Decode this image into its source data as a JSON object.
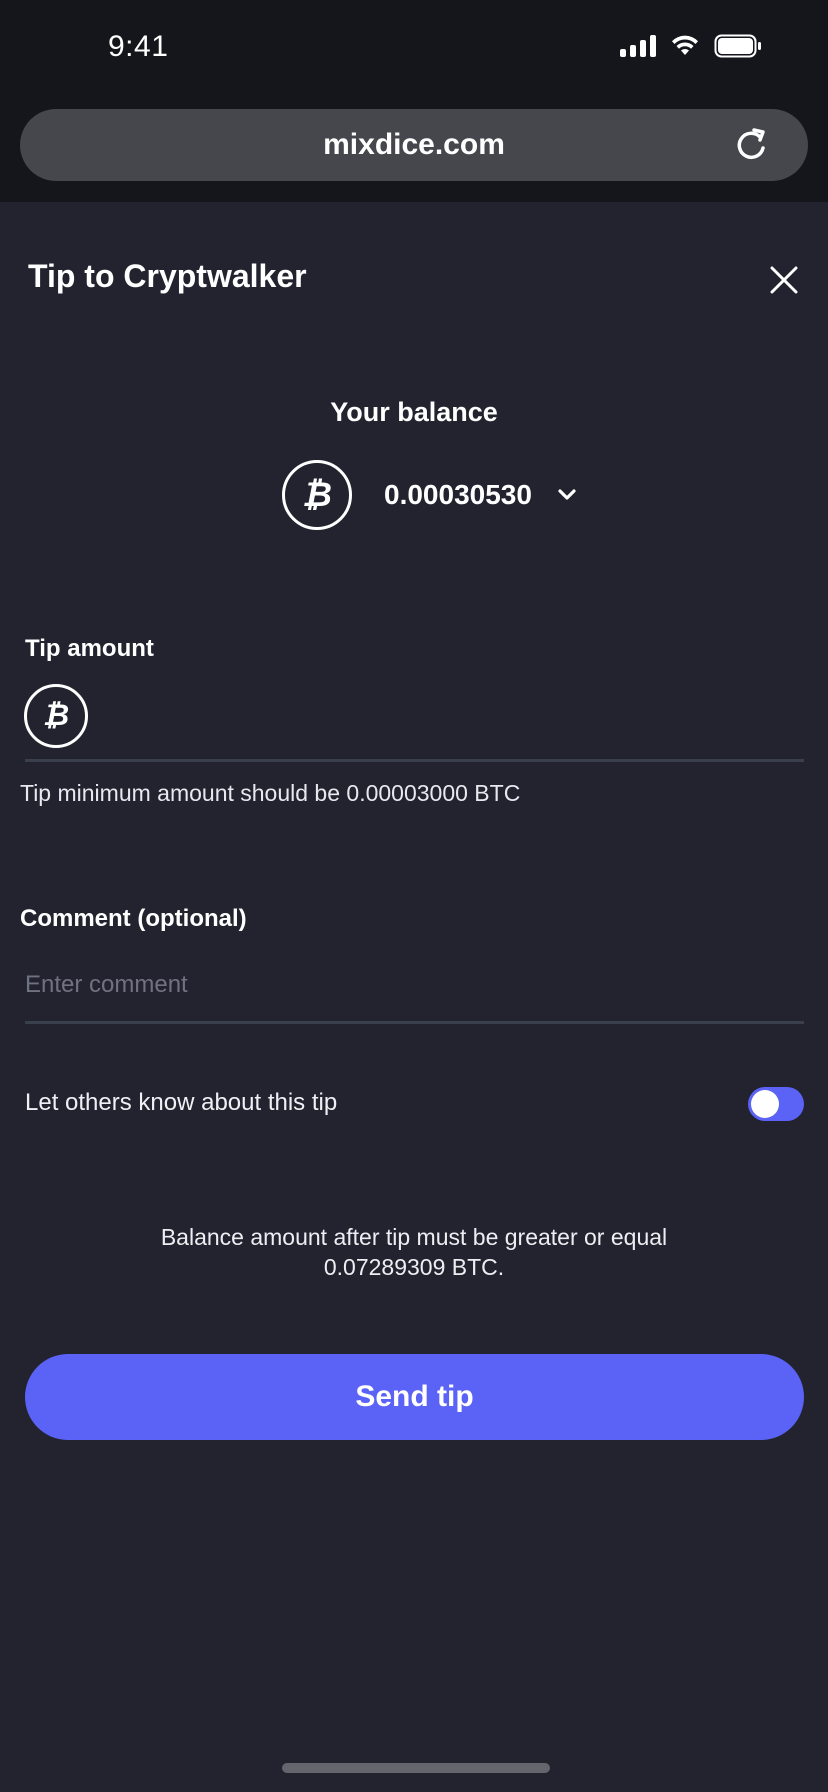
{
  "status_bar": {
    "time": "9:41"
  },
  "browser": {
    "url": "mixdice.com"
  },
  "modal": {
    "title": "Tip to Cryptwalker",
    "balance_label": "Your balance",
    "balance_value": "0.00030530",
    "currency_symbol": "₿",
    "tip_amount_label": "Tip amount",
    "tip_amount_value": "",
    "tip_hint": "Tip minimum amount should be 0.00003000 BTC",
    "comment_label": "Comment (optional)",
    "comment_placeholder": "Enter comment",
    "toggle_label": "Let others know about this tip",
    "toggle_state": "on",
    "balance_note_line1": "Balance amount after tip must be greater or equal",
    "balance_note_line2": "0.07289309 BTC.",
    "send_button": "Send tip"
  },
  "icons": {
    "reload": "reload-icon",
    "close": "close-icon",
    "coin": "bitcoin-icon",
    "chevron": "chevron-down-icon"
  },
  "colors": {
    "background": "#22232f",
    "chrome": "#15161c",
    "accent": "#5b63f7"
  }
}
